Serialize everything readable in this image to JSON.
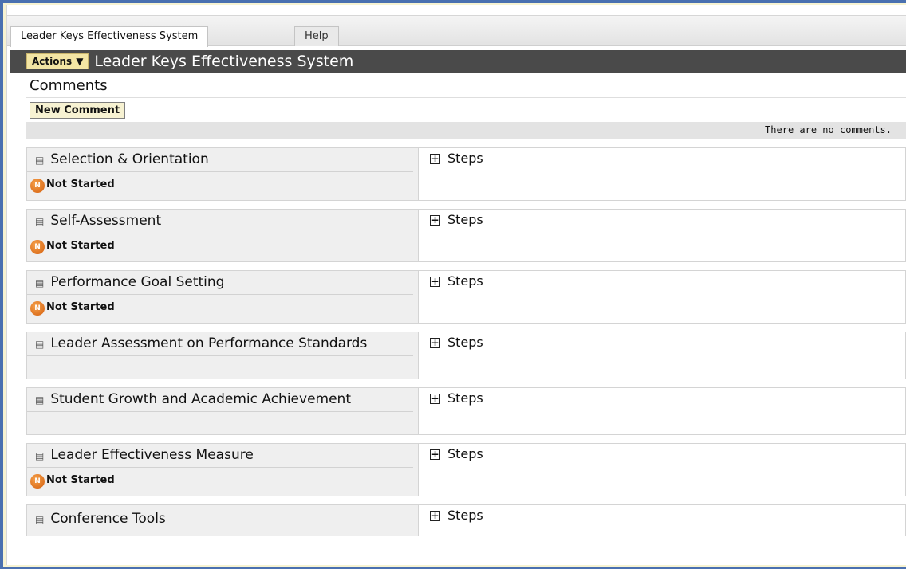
{
  "tabs": [
    {
      "label": "Leader Keys Effectiveness System",
      "active": true
    },
    {
      "label": "Help",
      "active": false
    }
  ],
  "header": {
    "actions_label": "Actions",
    "title": "Leader Keys Effectiveness System"
  },
  "comments": {
    "title": "Comments",
    "new_button": "New Comment",
    "empty_message": "There are no comments."
  },
  "steps_label": "Steps",
  "sections": [
    {
      "name": "Selection & Orientation",
      "status": "Not Started",
      "status_icon_letter": "N"
    },
    {
      "name": "Self-Assessment",
      "status": "Not Started",
      "status_icon_letter": "N"
    },
    {
      "name": "Performance Goal Setting",
      "status": "Not Started",
      "status_icon_letter": "N"
    },
    {
      "name": "Leader Assessment on Performance Standards"
    },
    {
      "name": "Student Growth and Academic Achievement"
    },
    {
      "name": "Leader Effectiveness Measure",
      "status": "Not Started",
      "status_icon_letter": "N"
    },
    {
      "name": "Conference Tools"
    }
  ],
  "colors": {
    "title_bar": "#4a4a4a",
    "actions_button": "#f3e5a4",
    "status_not_started": "#e57a1f",
    "window_frame": "#4a70b0"
  }
}
